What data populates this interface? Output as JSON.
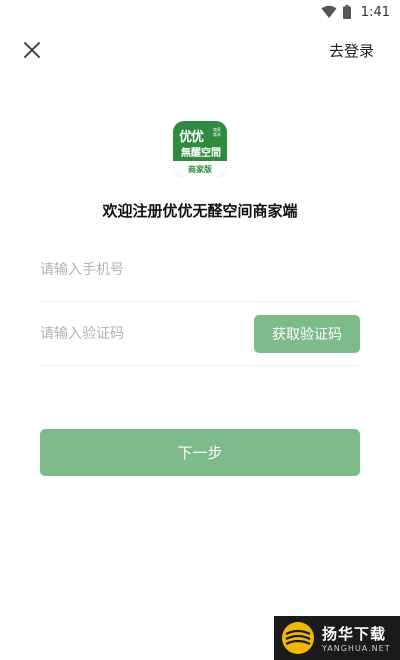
{
  "status_bar": {
    "time": "1:41"
  },
  "top_bar": {
    "login_link": "去登录"
  },
  "logo": {
    "line1": "优优",
    "sub": "商家版本",
    "line2": "無醒空間",
    "bottom": "商家版"
  },
  "welcome_text": "欢迎注册优优无醛空间商家端",
  "form": {
    "phone_placeholder": "请输入手机号",
    "code_placeholder": "请输入验证码",
    "get_code_label": "获取验证码",
    "next_label": "下一步"
  },
  "watermark": {
    "cn": "扬华下载",
    "en": "YANGHUA.NET"
  },
  "colors": {
    "brand_green": "#2e8b3f",
    "button_green": "#7dbb8a",
    "placeholder": "#b3b3b3"
  }
}
